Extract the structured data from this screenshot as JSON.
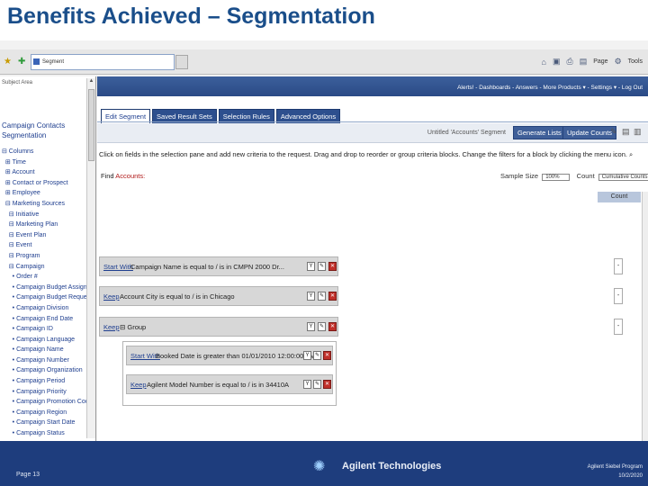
{
  "slide": {
    "title": "Benefits Achieved – Segmentation",
    "footer": {
      "page": "Page 13",
      "brand": "Agilent Technologies",
      "program": "Agilent Siebel Program",
      "date": "10/2/2020"
    }
  },
  "browser": {
    "address": "Segment",
    "toolbar": {
      "page_label": "Page",
      "tools_label": "Tools"
    }
  },
  "left_panel": {
    "subject_area": "Subject Area",
    "heading_line1": "Campaign Contacts",
    "heading_line2": "Segmentation",
    "tree": [
      "⊟ Columns",
      "  ⊞ Time",
      "  ⊞ Account",
      "  ⊞ Contact or Prospect",
      "  ⊞ Employee",
      "  ⊟ Marketing Sources",
      "    ⊟ Initiative",
      "    ⊟ Marketing Plan",
      "    ⊟ Event Plan",
      "    ⊟ Event",
      "    ⊟ Program",
      "    ⊟ Campaign",
      "      • Order #",
      "      • Campaign Budget Assigned",
      "      • Campaign Budget Requests",
      "      • Campaign Division",
      "      • Campaign End Date",
      "      • Campaign ID",
      "      • Campaign Language",
      "      • Campaign Name",
      "      • Campaign Number",
      "      • Campaign Organization",
      "      • Campaign Period",
      "      • Campaign Priority",
      "      • Campaign Promotion Code",
      "      • Campaign Region",
      "      • Campaign Start Date",
      "      • Campaign Status"
    ]
  },
  "main": {
    "top_links": "Alerts! - Dashboards - Answers - More Products ▾ - Settings ▾ - Log Out",
    "tabs": [
      {
        "label": "Edit Segment",
        "active": true
      },
      {
        "label": "Saved Result Sets",
        "active": false
      },
      {
        "label": "Selection Rules",
        "active": false
      },
      {
        "label": "Advanced Options",
        "active": false
      }
    ],
    "segment_title": "Untitled 'Accounts' Segment",
    "generate_lists": "Generate Lists",
    "update_counts": "Update Counts",
    "instructions": "Click on fields in the selection pane and add new criteria to the request. Drag and drop to reorder or group criteria blocks. Change the filters for a block by clicking the menu icon.",
    "find_label": "Find",
    "find_target": "Accounts:",
    "sample_size_label": "Sample Size",
    "sample_size_value": "100%",
    "count_label": "Count",
    "count_value": "Cumulative Counts",
    "count_header": "Count",
    "criteria": [
      {
        "keyword": "Start With",
        "text": "Campaign Name is equal to / is in CMPN 2000 Dr..."
      },
      {
        "keyword": "Keep",
        "text": "Account City is equal to / is in Chicago"
      },
      {
        "keyword": "Keep",
        "text": "⊟ Group"
      },
      {
        "keyword": "Start With",
        "text": "Booked Date is greater than 01/01/2010 12:00:00 AM"
      },
      {
        "keyword": "Keep",
        "text": "Agilent Model Number is equal to / is in 34410A"
      }
    ],
    "counts": [
      "-",
      "-",
      "-"
    ]
  }
}
